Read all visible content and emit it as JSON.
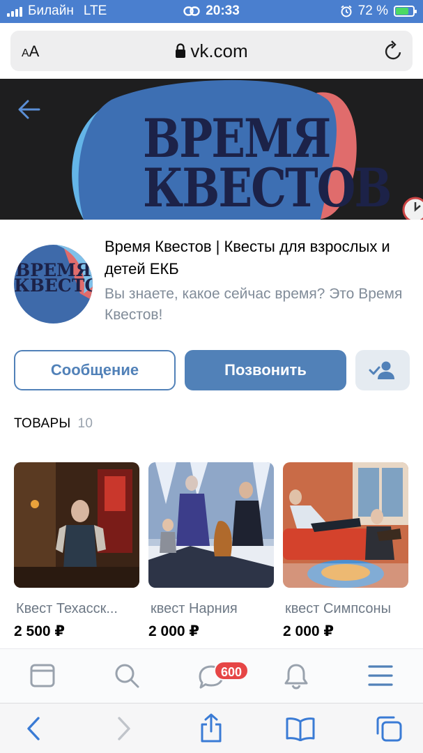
{
  "status_bar": {
    "carrier": "Билайн",
    "network": "LTE",
    "time": "20:33",
    "battery": "72 %",
    "background": "#4a7fcf"
  },
  "browser": {
    "text_size_label_small": "A",
    "text_size_label_big": "A",
    "url": "vk.com"
  },
  "cover": {
    "title_line1": "ВРЕМЯ",
    "title_line2": "КВЕСТОВ"
  },
  "avatar": {
    "line1": "ВРЕМЯ",
    "line2": "КВЕСТОВ"
  },
  "group": {
    "name": "Время Квестов | Квесты для взрослых и детей ЕКБ",
    "status": "Вы знаете, какое сейчас время? Это Время Квестов!"
  },
  "actions": {
    "message": "Сообщение",
    "call": "Позвонить"
  },
  "goods": {
    "title": "ТОВАРЫ",
    "count": "10",
    "items": [
      {
        "name": "Квест Техасск...",
        "price": "2 500 ₽"
      },
      {
        "name": "квест Нарния",
        "price": "2 000 ₽"
      },
      {
        "name": "квест Симпсоны",
        "price": "2 000 ₽"
      }
    ]
  },
  "tabbar": {
    "messages_badge": "600"
  },
  "colors": {
    "accent": "#5181b8",
    "badge": "#e64646",
    "secondary_text": "#818c99"
  }
}
